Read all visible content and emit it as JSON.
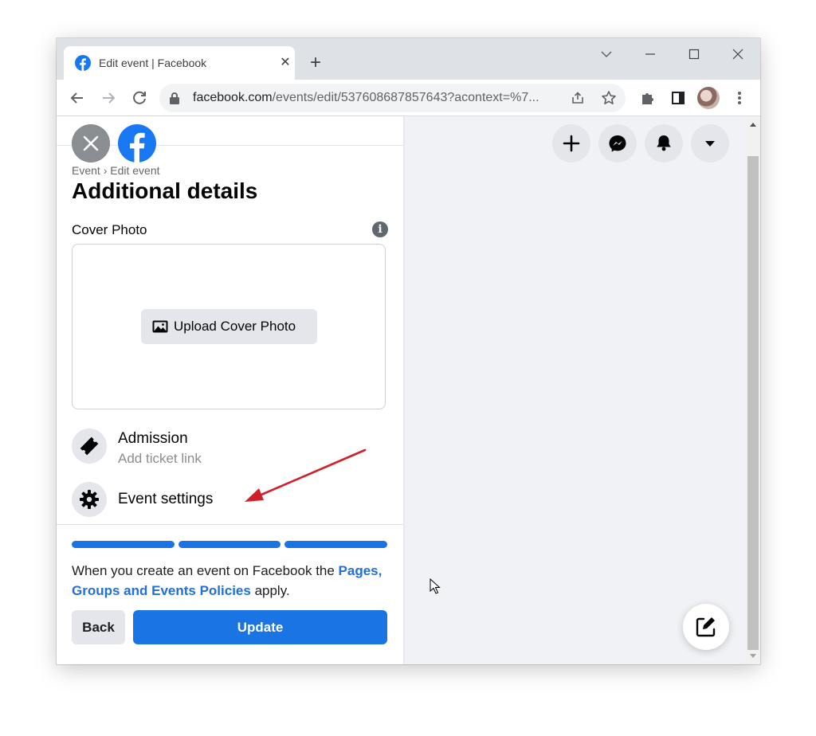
{
  "browser": {
    "tab_title": "Edit event | Facebook",
    "tab_close": "✕",
    "new_tab": "+",
    "url_domain": "facebook.com",
    "url_path": "/events/edit/537608687857643?acontext=%7..."
  },
  "panel": {
    "breadcrumb": "Event › Edit event",
    "title": "Additional details",
    "cover_label": "Cover Photo",
    "info_icon": "i",
    "upload_label": "Upload Cover Photo",
    "admission_title": "Admission",
    "admission_sub": "Add ticket link",
    "event_settings": "Event settings",
    "policy_text_before": "When you create an event on Facebook the ",
    "policy_link": "Pages, Groups and Events Policies",
    "policy_text_after": " apply.",
    "back_label": "Back",
    "update_label": "Update"
  },
  "progress": {
    "steps_total": 3,
    "steps_complete": 3
  },
  "colors": {
    "accent": "#1b74e4",
    "link": "#216fdb",
    "annotation_arrow": "#d0202a",
    "page_bg": "#f0f2f5"
  },
  "icons": [
    "facebook-favicon",
    "back-arrow-icon",
    "forward-arrow-icon",
    "reload-icon",
    "lock-icon",
    "share-icon",
    "star-icon",
    "extensions-icon",
    "sidepanel-icon",
    "menu-dots-icon",
    "close-icon",
    "facebook-logo",
    "photo-icon",
    "ticket-icon",
    "gear-icon",
    "plus-icon",
    "messenger-icon",
    "bell-icon",
    "caret-down-icon",
    "compose-icon",
    "annotation-arrow",
    "mouse-cursor"
  ]
}
